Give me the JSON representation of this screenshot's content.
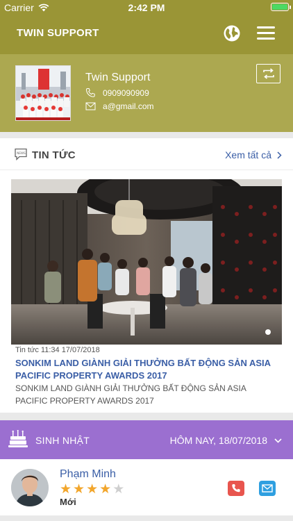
{
  "status_bar": {
    "carrier": "Carrier",
    "time": "2:42 PM",
    "battery_level": 1.0
  },
  "nav": {
    "title": "TWIN SUPPORT",
    "globe_icon": "globe-icon",
    "menu_icon": "hamburger-menu-icon"
  },
  "profile": {
    "name": "Twin Support",
    "phone": "0909090909",
    "email": "a@gmail.com",
    "switch_icon": "switch-account-icon"
  },
  "news": {
    "section_title": "TIN TỨC",
    "see_all": "Xem tất cả",
    "item": {
      "category": "Tin tức",
      "time": "11:34 17/07/2018",
      "headline": "SONKIM LAND GIÀNH GIẢI THƯỞNG BẤT ĐỘNG SẢN ASIA PACIFIC PROPERTY AWARDS 2017",
      "summary": "SONKIM LAND GIÀNH GIẢI THƯỞNG BẤT ĐỘNG SẢN ASIA PACIFIC PROPERTY AWARDS 2017"
    }
  },
  "birthday": {
    "section_title": "SINH NHẬT",
    "date_label": "HÔM NAY, 18/07/2018",
    "person": {
      "name": "Phạm Minh",
      "rating": 4,
      "rating_max": 5,
      "status": "Mới"
    }
  },
  "colors": {
    "header": "#9a9536",
    "profile": "#aca850",
    "link": "#3a5ea6",
    "birthday": "#9b6fd0",
    "call": "#e8554e",
    "mail": "#2e9fe0",
    "star": "#f2a62c"
  }
}
